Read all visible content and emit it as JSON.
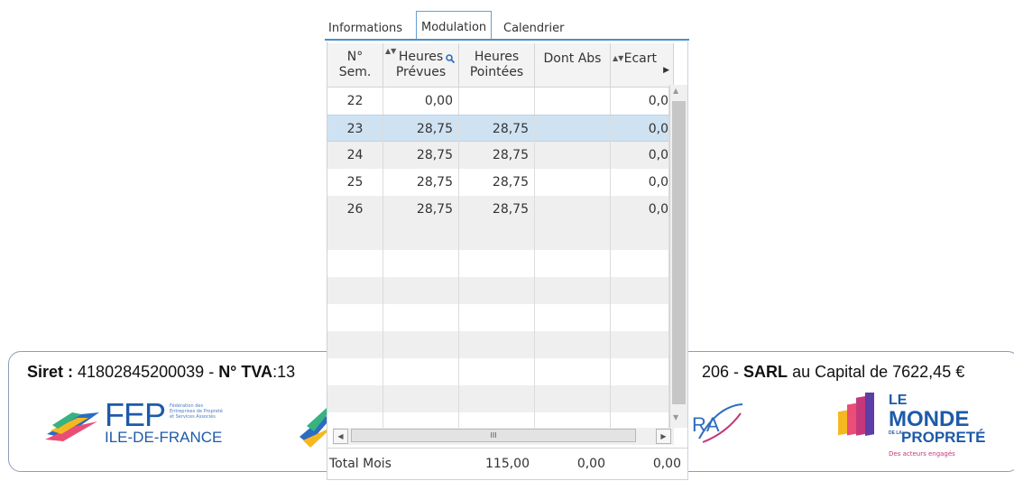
{
  "tabs": [
    {
      "label": "Informations",
      "active": false
    },
    {
      "label": "Modulation",
      "active": true
    },
    {
      "label": "Calendrier",
      "active": false
    }
  ],
  "grid": {
    "columns": [
      {
        "line1": "N°",
        "line2": "Sem."
      },
      {
        "line1": "Heures",
        "line2": "Prévues"
      },
      {
        "line1": "Heures",
        "line2": "Pointées"
      },
      {
        "line1": "Dont Abs",
        "line2": ""
      },
      {
        "line1": "Ecart",
        "line2": ""
      }
    ],
    "rows": [
      {
        "sem": "22",
        "prevues": "0,00",
        "pointees": "",
        "dont_abs": "",
        "ecart": "0,0"
      },
      {
        "sem": "23",
        "prevues": "28,75",
        "pointees": "28,75",
        "dont_abs": "",
        "ecart": "0,0"
      },
      {
        "sem": "24",
        "prevues": "28,75",
        "pointees": "28,75",
        "dont_abs": "",
        "ecart": "0,0"
      },
      {
        "sem": "25",
        "prevues": "28,75",
        "pointees": "28,75",
        "dont_abs": "",
        "ecart": "0,0"
      },
      {
        "sem": "26",
        "prevues": "28,75",
        "pointees": "28,75",
        "dont_abs": "",
        "ecart": "0,0"
      }
    ],
    "selected_row": "23",
    "hscroll_grip": "III",
    "total": {
      "label": "Total Mois",
      "pointees": "115,00",
      "dont_abs": "0,00",
      "ecart": "0,00"
    }
  },
  "footer": {
    "siret_label": "Siret :",
    "siret_value": "41802845200039",
    "tva_label": "N° TVA",
    "tva_value": ":13",
    "right_code": "206",
    "sarl_label": "SARL",
    "capital_text": "au Capital de 7622,45 €",
    "fep_big": "FEP",
    "fep_small": "Fédération des Entreprises de Propreté et Services Associés",
    "fep_region": "ILE-DE-FRANCE",
    "monde_line1": "LE",
    "monde_line2": "MONDE",
    "monde_line3": "PROPRETÉ",
    "monde_de_la": "DE LA",
    "monde_tag": "Des acteurs engagés",
    "ra_text": "RA"
  },
  "colors": {
    "tab_rule": "#4a90c8",
    "selected_row": "#cfe2f1",
    "footer_border": "#8a9fb8",
    "brand_blue": "#1e5aa8",
    "brand_pink": "#c4387a"
  }
}
